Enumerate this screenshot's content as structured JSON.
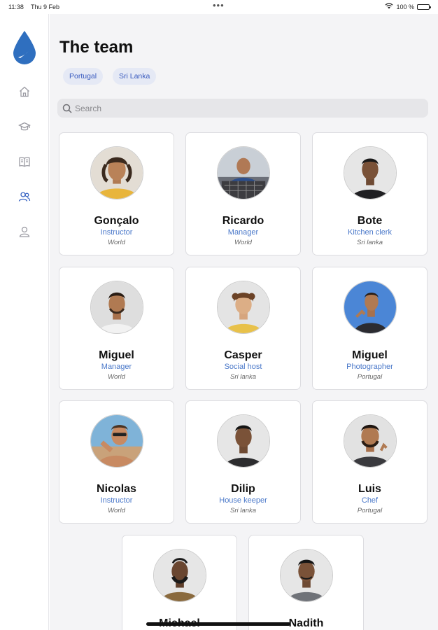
{
  "status_bar": {
    "time": "11:38",
    "date": "Thu 9 Feb",
    "multitask_dots": "•••",
    "battery_text": "100 %",
    "wifi_icon": "wifi-icon",
    "battery_icon": "battery-icon"
  },
  "sidebar": {
    "logo_icon": "water-drop-logo",
    "items": [
      {
        "icon": "home-icon",
        "active": false
      },
      {
        "icon": "graduation-cap-icon",
        "active": false
      },
      {
        "icon": "book-icon",
        "active": false
      },
      {
        "icon": "team-icon",
        "active": true
      },
      {
        "icon": "profile-icon",
        "active": false
      }
    ],
    "active_color": "#3a66c4",
    "inactive_color": "#9a9aa2"
  },
  "header": {
    "title": "The team",
    "filters": [
      "Portugal",
      "Sri Lanka"
    ]
  },
  "search": {
    "placeholder": "Search",
    "value": ""
  },
  "colors": {
    "accent": "#4a78c9",
    "chip_bg": "#e5e9f5",
    "background": "#f4f4f6"
  },
  "team": [
    {
      "name": "Gonçalo",
      "role": "Instructor",
      "location": "World"
    },
    {
      "name": "Ricardo",
      "role": "Manager",
      "location": "World"
    },
    {
      "name": "Bote",
      "role": "Kitchen clerk",
      "location": "Sri lanka"
    },
    {
      "name": "Miguel",
      "role": "Manager",
      "location": "World"
    },
    {
      "name": "Casper",
      "role": "Social host",
      "location": "Sri lanka"
    },
    {
      "name": "Miguel",
      "role": "Photographer",
      "location": "Portugal"
    },
    {
      "name": "Nicolas",
      "role": "Instructor",
      "location": "World"
    },
    {
      "name": "Dilip",
      "role": "House keeper",
      "location": "Sri lanka"
    },
    {
      "name": "Luis",
      "role": "Chef",
      "location": "Portugal"
    },
    {
      "name": "Michael",
      "role": "",
      "location": ""
    },
    {
      "name": "Nadith",
      "role": "",
      "location": ""
    }
  ]
}
